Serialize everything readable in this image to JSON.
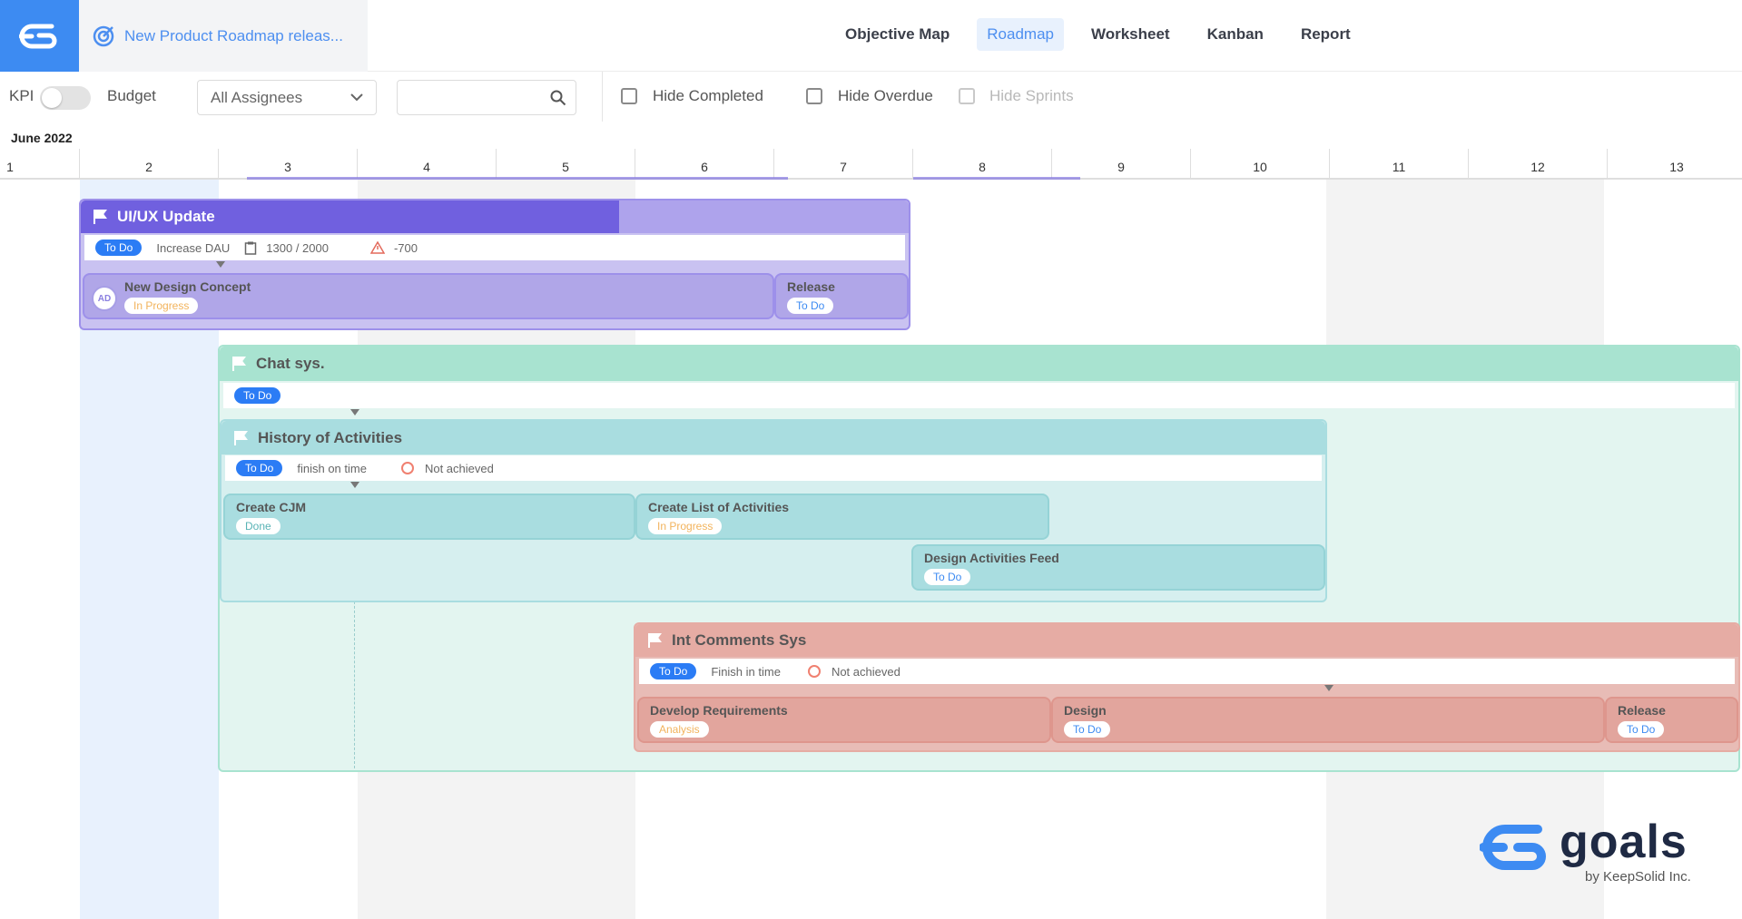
{
  "header": {
    "project_title": "New Product Roadmap releas...",
    "tabs": [
      {
        "label": "Objective Map",
        "active": false
      },
      {
        "label": "Roadmap",
        "active": true
      },
      {
        "label": "Worksheet",
        "active": false
      },
      {
        "label": "Kanban",
        "active": false
      },
      {
        "label": "Report",
        "active": false
      }
    ]
  },
  "toolbar": {
    "kpi_label": "KPI",
    "kpi_toggle_on": false,
    "budget_label": "Budget",
    "assignee_value": "All Assignees",
    "search_value": "",
    "filters": [
      {
        "label": "Hide Completed",
        "checked": false,
        "enabled": true
      },
      {
        "label": "Hide Overdue",
        "checked": false,
        "enabled": true
      },
      {
        "label": "Hide Sprints",
        "checked": false,
        "enabled": false
      }
    ]
  },
  "timeline": {
    "month": "June 2022",
    "days": [
      "1",
      "2",
      "3",
      "4",
      "5",
      "6",
      "7",
      "8",
      "9",
      "10",
      "11",
      "12",
      "13"
    ]
  },
  "goals": {
    "uiux": {
      "title": "UI/UX Update",
      "status": "To Do",
      "kpi": "Increase DAU",
      "progress": "1300 / 2000",
      "delta": "-700",
      "progress_fraction": 0.65,
      "tasks": [
        {
          "name": "New Design Concept",
          "status": "In Progress",
          "assignee": "AD"
        },
        {
          "name": "Release",
          "status": "To Do"
        }
      ]
    },
    "chat": {
      "title": "Chat sys.",
      "status": "To Do"
    },
    "history": {
      "title": "History of Activities",
      "status": "To Do",
      "kpi": "finish on time",
      "result": "Not achieved",
      "tasks": [
        {
          "name": "Create CJM",
          "status": "Done"
        },
        {
          "name": "Create List of Activities",
          "status": "In Progress"
        },
        {
          "name": "Design Activities Feed",
          "status": "To Do"
        }
      ]
    },
    "comments": {
      "title": "Int Comments Sys",
      "status": "To Do",
      "kpi": "Finish in time",
      "result": "Not achieved",
      "tasks": [
        {
          "name": "Develop Requirements",
          "status": "Analysis"
        },
        {
          "name": "Design",
          "status": "To Do"
        },
        {
          "name": "Release",
          "status": "To Do"
        }
      ]
    }
  },
  "brand": {
    "name": "goals",
    "tagline": "by KeepSolid Inc."
  },
  "colors": {
    "accent": "#3d8bf2",
    "uiux": "#7c6ee0",
    "chat": "#a8e3d0",
    "history": "#a9dde0",
    "comments": "#e6aca4"
  }
}
